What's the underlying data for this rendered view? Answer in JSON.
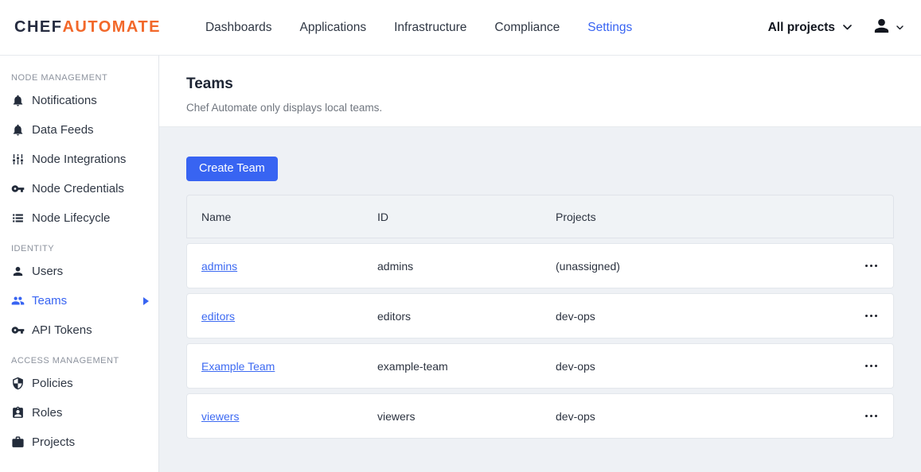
{
  "brand": {
    "chef": "CHEF",
    "automate": "AUTOMATE"
  },
  "topnav": {
    "items": [
      {
        "label": "Dashboards"
      },
      {
        "label": "Applications"
      },
      {
        "label": "Infrastructure"
      },
      {
        "label": "Compliance"
      },
      {
        "label": "Settings"
      }
    ],
    "active_item": "Settings",
    "projects_filter": {
      "label": "All projects"
    }
  },
  "sidebar": {
    "groups": [
      {
        "label": "NODE MANAGEMENT",
        "items": [
          {
            "label": "Notifications",
            "icon": "bell-icon"
          },
          {
            "label": "Data Feeds",
            "icon": "bell-icon"
          },
          {
            "label": "Node Integrations",
            "icon": "sliders-icon"
          },
          {
            "label": "Node Credentials",
            "icon": "key-icon"
          },
          {
            "label": "Node Lifecycle",
            "icon": "list-icon"
          }
        ]
      },
      {
        "label": "IDENTITY",
        "items": [
          {
            "label": "Users",
            "icon": "person-icon"
          },
          {
            "label": "Teams",
            "icon": "group-icon",
            "active": true
          },
          {
            "label": "API Tokens",
            "icon": "key-icon"
          }
        ]
      },
      {
        "label": "ACCESS MANAGEMENT",
        "items": [
          {
            "label": "Policies",
            "icon": "shield-icon"
          },
          {
            "label": "Roles",
            "icon": "badge-icon"
          },
          {
            "label": "Projects",
            "icon": "briefcase-icon"
          }
        ]
      }
    ]
  },
  "page": {
    "title": "Teams",
    "subtitle": "Chef Automate only displays local teams.",
    "create_button_label": "Create Team"
  },
  "table": {
    "columns": [
      {
        "label": "Name"
      },
      {
        "label": "ID"
      },
      {
        "label": "Projects"
      }
    ],
    "rows": [
      {
        "name": "admins",
        "id": "admins",
        "projects": "(unassigned)"
      },
      {
        "name": "editors",
        "id": "editors",
        "projects": "dev-ops"
      },
      {
        "name": "Example Team",
        "id": "example-team",
        "projects": "dev-ops"
      },
      {
        "name": "viewers",
        "id": "viewers",
        "projects": "dev-ops"
      }
    ]
  },
  "colors": {
    "accent": "#3864f2",
    "brand_orange": "#f2682a",
    "brand_dark": "#262c40",
    "page_bg": "#eef1f5"
  }
}
